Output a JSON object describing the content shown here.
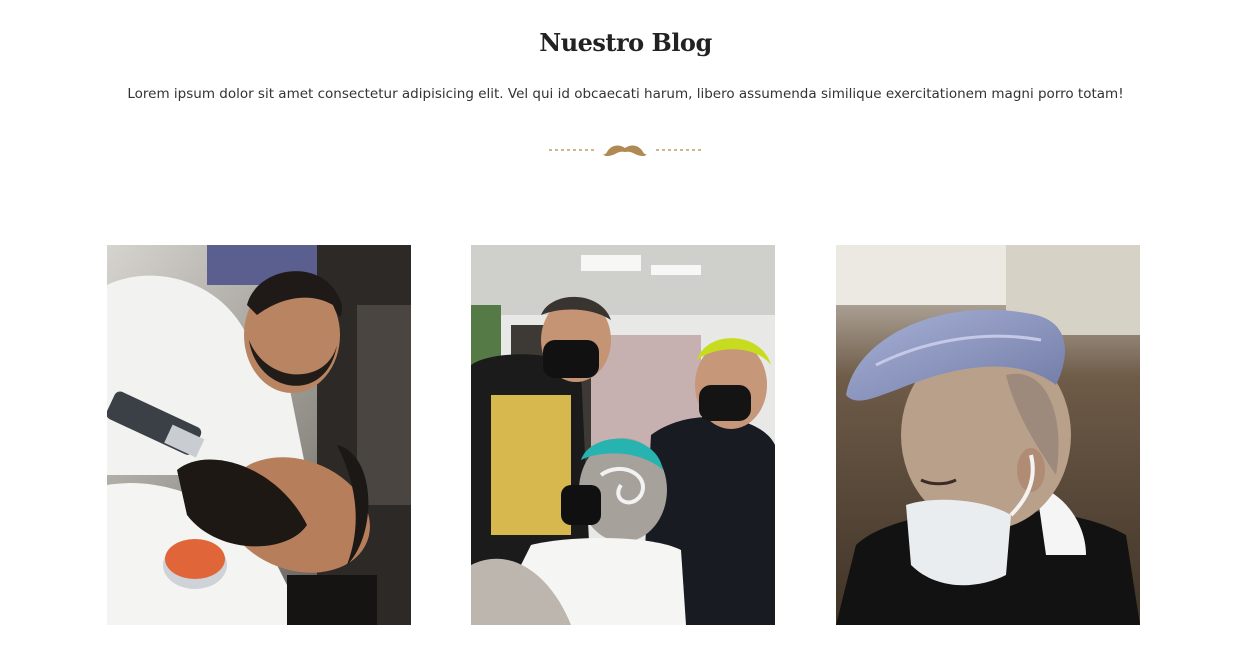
{
  "section": {
    "title": "Nuestro Blog",
    "subtitle": "Lorem ipsum dolor sit amet consectetur adipisicing elit. Vel qui id obcaecati harum, libero assumenda similique exercitationem magni porro totam!",
    "divider_icon": "mustache-icon"
  },
  "colors": {
    "accent": "#b08a52",
    "title": "#222222",
    "text": "#333333"
  },
  "posts": [
    {
      "image": "barber-trimming-beard-photo"
    },
    {
      "image": "barber-design-haircut-photo"
    },
    {
      "image": "silver-pompadour-haircut-photo"
    }
  ]
}
